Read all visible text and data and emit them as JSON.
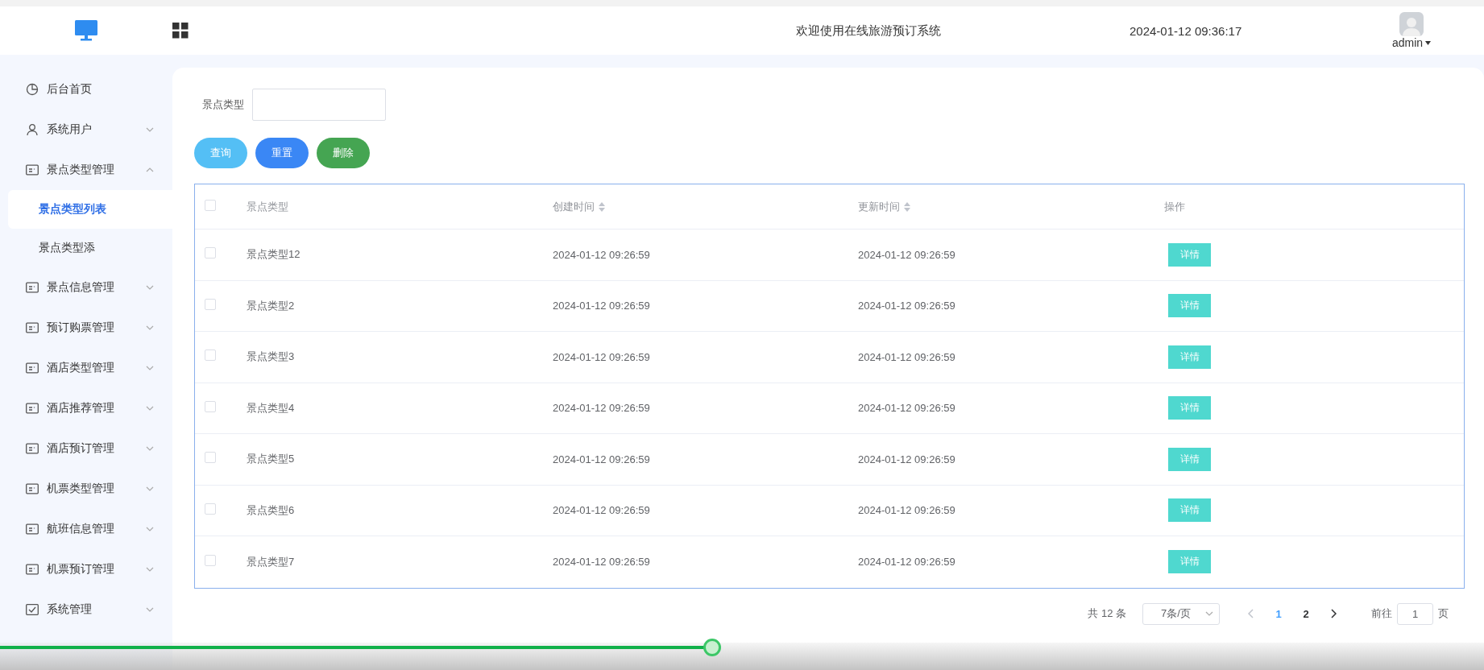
{
  "header": {
    "title": "欢迎使用在线旅游预订系统",
    "datetime": "2024-01-12 09:36:17",
    "user": "admin"
  },
  "sidebar": {
    "items": [
      {
        "label": "后台首页",
        "kind": "chart"
      },
      {
        "label": "系统用户",
        "kind": "user",
        "expanded": false
      },
      {
        "label": "景点类型管理",
        "kind": "card",
        "expanded": true,
        "children": [
          {
            "label": "景点类型列表",
            "selected": true
          },
          {
            "label": "景点类型添",
            "selected": false
          }
        ]
      },
      {
        "label": "景点信息管理",
        "kind": "card",
        "expanded": false
      },
      {
        "label": "预订购票管理",
        "kind": "card",
        "expanded": false
      },
      {
        "label": "酒店类型管理",
        "kind": "card",
        "expanded": false
      },
      {
        "label": "酒店推荐管理",
        "kind": "card",
        "expanded": false
      },
      {
        "label": "酒店预订管理",
        "kind": "card",
        "expanded": false
      },
      {
        "label": "机票类型管理",
        "kind": "card",
        "expanded": false
      },
      {
        "label": "航班信息管理",
        "kind": "card",
        "expanded": false
      },
      {
        "label": "机票预订管理",
        "kind": "card",
        "expanded": false
      },
      {
        "label": "系统管理",
        "kind": "check",
        "expanded": false
      }
    ]
  },
  "search": {
    "label": "景点类型"
  },
  "buttons": [
    {
      "label": "查询",
      "kind": "query"
    },
    {
      "label": "重置",
      "kind": "reset"
    },
    {
      "label": "删除",
      "kind": "delete"
    }
  ],
  "table": {
    "all_checked": false,
    "columns": [
      {
        "label": "景点类型",
        "sortable": false
      },
      {
        "label": "创建时间",
        "sortable": true
      },
      {
        "label": "更新时间",
        "sortable": true
      },
      {
        "label": "操作",
        "sortable": false
      }
    ],
    "rows": [
      {
        "checked": false,
        "type": "景点类型12",
        "created": "2024-01-12 09:26:59",
        "updated": "2024-01-12 09:26:59",
        "action": "详情"
      },
      {
        "checked": false,
        "type": "景点类型2",
        "created": "2024-01-12 09:26:59",
        "updated": "2024-01-12 09:26:59",
        "action": "详情"
      },
      {
        "checked": false,
        "type": "景点类型3",
        "created": "2024-01-12 09:26:59",
        "updated": "2024-01-12 09:26:59",
        "action": "详情"
      },
      {
        "checked": false,
        "type": "景点类型4",
        "created": "2024-01-12 09:26:59",
        "updated": "2024-01-12 09:26:59",
        "action": "详情"
      },
      {
        "checked": false,
        "type": "景点类型5",
        "created": "2024-01-12 09:26:59",
        "updated": "2024-01-12 09:26:59",
        "action": "详情"
      },
      {
        "checked": false,
        "type": "景点类型6",
        "created": "2024-01-12 09:26:59",
        "updated": "2024-01-12 09:26:59",
        "action": "详情"
      },
      {
        "checked": false,
        "type": "景点类型7",
        "created": "2024-01-12 09:26:59",
        "updated": "2024-01-12 09:26:59",
        "action": "详情"
      }
    ]
  },
  "pagination": {
    "total": "共 12 条",
    "page_size": "7条/页",
    "pages": [
      {
        "label": "1",
        "selected": true
      },
      {
        "label": "2",
        "selected": false
      }
    ],
    "goto_label": "前往",
    "goto_value": "1",
    "goto_suffix": "页"
  },
  "video_progress": {
    "level": 0.48
  }
}
